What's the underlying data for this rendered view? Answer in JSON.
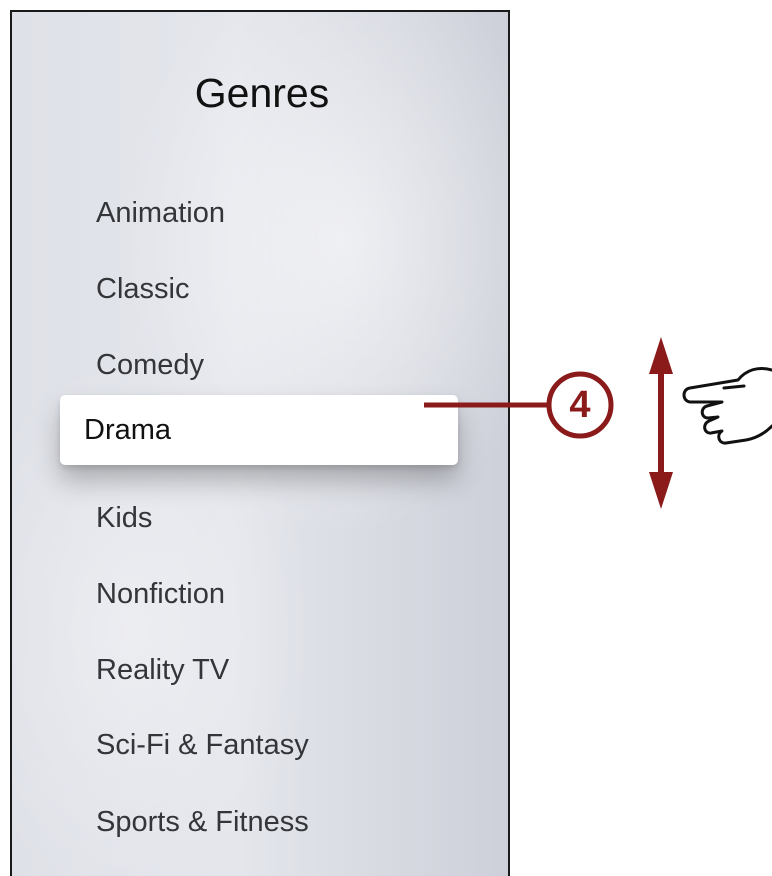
{
  "menu": {
    "title": "Genres",
    "items": [
      {
        "label": "Animation"
      },
      {
        "label": "Classic"
      },
      {
        "label": "Comedy"
      },
      {
        "label": "Drama",
        "selected": true
      },
      {
        "label": "Kids"
      },
      {
        "label": "Nonfiction"
      },
      {
        "label": "Reality TV"
      },
      {
        "label": "Sci-Fi & Fantasy"
      },
      {
        "label": "Sports & Fitness"
      }
    ]
  },
  "callout": {
    "number": "4",
    "color": "#8b1a1a",
    "icons": [
      "up-down-arrow-icon",
      "pointing-hand-icon"
    ]
  }
}
